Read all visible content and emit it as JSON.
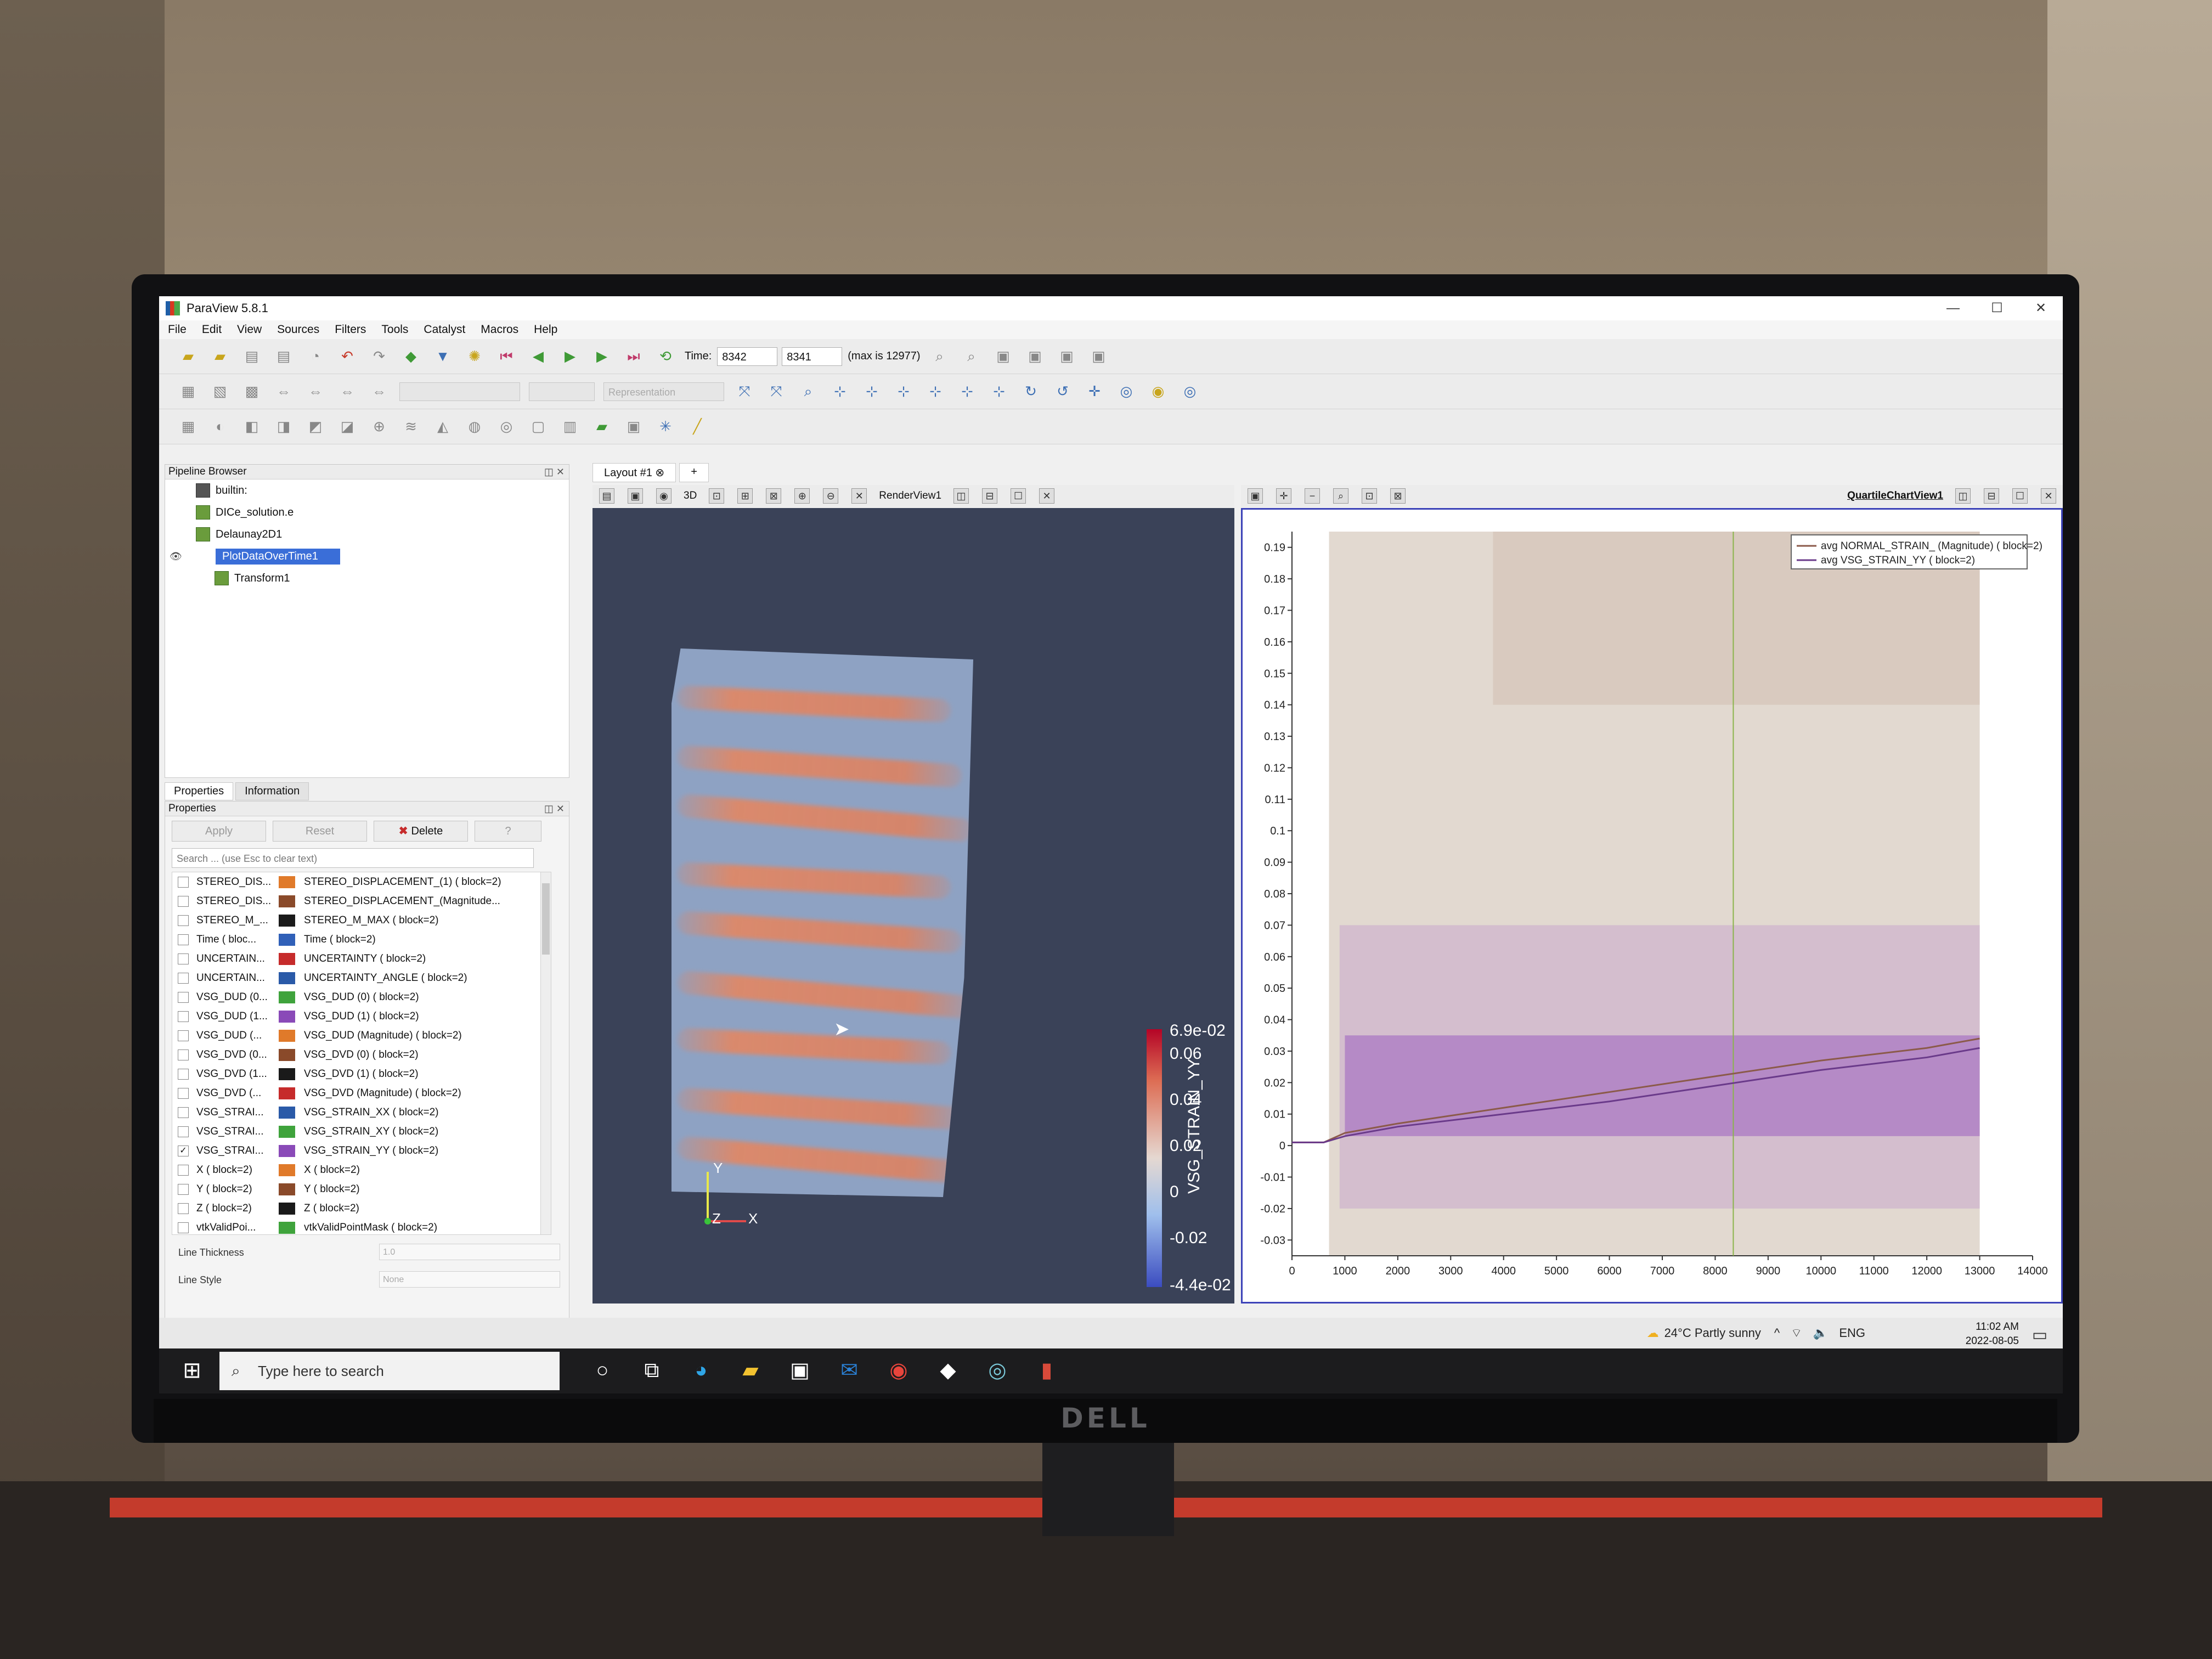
{
  "window": {
    "title": "ParaView 5.8.1"
  },
  "menu": [
    "File",
    "Edit",
    "View",
    "Sources",
    "Filters",
    "Tools",
    "Catalyst",
    "Macros",
    "Help"
  ],
  "time": {
    "label": "Time:",
    "value": "8342",
    "index": "8341",
    "max": "(max is 12977)"
  },
  "representation_placeholder": "Representation",
  "pipeline": {
    "title": "Pipeline Browser",
    "items": [
      "builtin:",
      "DICe_solution.e",
      "Delaunay2D1",
      "PlotDataOverTime1",
      "Transform1"
    ]
  },
  "props": {
    "tabs": [
      "Properties",
      "Information"
    ],
    "title": "Properties",
    "apply": "Apply",
    "reset": "Reset",
    "delete": "Delete",
    "help": "?",
    "search_placeholder": "Search ... (use Esc to clear text)",
    "arrays": [
      {
        "name": "STEREO_DIS...",
        "full": "STEREO_DISPLACEMENT_(1) ( block=2)",
        "color": "#e07a2a",
        "checked": false
      },
      {
        "name": "STEREO_DIS...",
        "full": "STEREO_DISPLACEMENT_(Magnitude...",
        "color": "#8a4a2a",
        "checked": false
      },
      {
        "name": "STEREO_M_...",
        "full": "STEREO_M_MAX ( block=2)",
        "color": "#1a1a1a",
        "checked": false
      },
      {
        "name": "Time ( bloc...",
        "full": "Time ( block=2)",
        "color": "#3060b8",
        "checked": false
      },
      {
        "name": "UNCERTAIN...",
        "full": "UNCERTAINTY ( block=2)",
        "color": "#c62b2b",
        "checked": false
      },
      {
        "name": "UNCERTAIN...",
        "full": "UNCERTAINTY_ANGLE ( block=2)",
        "color": "#2a5aa8",
        "checked": false
      },
      {
        "name": "VSG_DUD (0...",
        "full": "VSG_DUD (0) ( block=2)",
        "color": "#3fa33c",
        "checked": false
      },
      {
        "name": "VSG_DUD (1...",
        "full": "VSG_DUD (1) ( block=2)",
        "color": "#8a4ab8",
        "checked": false
      },
      {
        "name": "VSG_DUD (...",
        "full": "VSG_DUD (Magnitude) ( block=2)",
        "color": "#e07a2a",
        "checked": false
      },
      {
        "name": "VSG_DVD (0...",
        "full": "VSG_DVD (0) ( block=2)",
        "color": "#8a4a2a",
        "checked": false
      },
      {
        "name": "VSG_DVD (1...",
        "full": "VSG_DVD (1) ( block=2)",
        "color": "#1a1a1a",
        "checked": false
      },
      {
        "name": "VSG_DVD (...",
        "full": "VSG_DVD (Magnitude) ( block=2)",
        "color": "#c62b2b",
        "checked": false
      },
      {
        "name": "VSG_STRAI...",
        "full": "VSG_STRAIN_XX ( block=2)",
        "color": "#2a5aa8",
        "checked": false
      },
      {
        "name": "VSG_STRAI...",
        "full": "VSG_STRAIN_XY ( block=2)",
        "color": "#3fa33c",
        "checked": false
      },
      {
        "name": "VSG_STRAI...",
        "full": "VSG_STRAIN_YY ( block=2)",
        "color": "#8a4ab8",
        "checked": true
      },
      {
        "name": "X ( block=2)",
        "full": "X ( block=2)",
        "color": "#e07a2a",
        "checked": false
      },
      {
        "name": "Y ( block=2)",
        "full": "Y ( block=2)",
        "color": "#8a4a2a",
        "checked": false
      },
      {
        "name": "Z ( block=2)",
        "full": "Z ( block=2)",
        "color": "#1a1a1a",
        "checked": false
      },
      {
        "name": "vtkValidPoi...",
        "full": "vtkValidPointMask ( block=2)",
        "color": "#3fa33c",
        "checked": false
      }
    ],
    "line_thickness_label": "Line Thickness",
    "line_thickness_value": "1.0",
    "line_style_label": "Line Style",
    "line_style_value": "None"
  },
  "layout": {
    "tab": "Layout #1",
    "add": "+",
    "render_view": "RenderView1",
    "chart_view": "QuartileChartView1",
    "mode_3d": "3D"
  },
  "colorbar": {
    "title": "VSG_STRAIN_YY",
    "labels": [
      "6.9e-02",
      "0.06",
      "0.04",
      "0.02",
      "0",
      "-0.02",
      "-4.4e-02"
    ]
  },
  "axes_labels": {
    "y": "Y",
    "z": "Z",
    "x": "X"
  },
  "chart_data": {
    "type": "area",
    "x_ticks": [
      0,
      1000,
      2000,
      3000,
      4000,
      5000,
      6000,
      7000,
      8000,
      9000,
      10000,
      11000,
      12000,
      13000,
      14000
    ],
    "y_ticks": [
      0.19,
      0.18,
      0.17,
      0.16,
      0.15,
      0.14,
      0.13,
      0.12,
      0.11,
      0.1,
      0.09,
      0.08,
      0.07,
      0.06,
      0.05,
      0.04,
      0.03,
      0.02,
      0.01,
      0,
      -0.01,
      -0.02,
      -0.03
    ],
    "xlim": [
      0,
      14000
    ],
    "ylim": [
      -0.035,
      0.195
    ],
    "current_time": 8342,
    "legend_position": "top-right",
    "series": [
      {
        "name": "avg NORMAL_STRAIN_ (Magnitude) ( block=2)",
        "color": "#8b5a4a",
        "x": [
          0,
          600,
          1000,
          2000,
          4000,
          6000,
          8000,
          10000,
          12000,
          13000
        ],
        "y": [
          0.001,
          0.001,
          0.004,
          0.007,
          0.012,
          0.017,
          0.022,
          0.027,
          0.031,
          0.034
        ]
      },
      {
        "name": "avg VSG_STRAIN_YY ( block=2)",
        "color": "#6a3a8a",
        "x": [
          0,
          600,
          1000,
          2000,
          4000,
          6000,
          8000,
          10000,
          12000,
          13000
        ],
        "y": [
          0.001,
          0.001,
          0.003,
          0.006,
          0.01,
          0.014,
          0.019,
          0.024,
          0.028,
          0.031
        ]
      }
    ]
  },
  "taskbar": {
    "search_placeholder": "Type here to search",
    "weather": "24°C  Partly sunny",
    "lang": "ENG",
    "time": "11:02 AM",
    "date": "2022-08-05"
  },
  "brand": "DELL"
}
